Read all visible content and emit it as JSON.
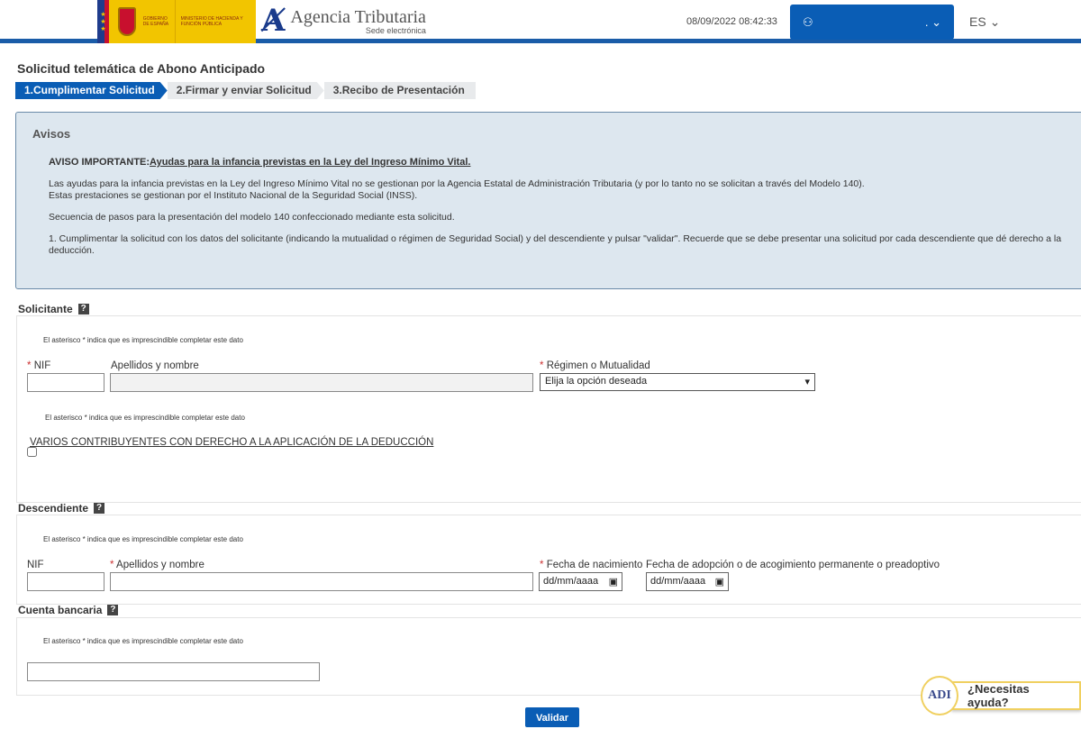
{
  "header": {
    "gov_label": "GOBIERNO DE ESPAÑA",
    "ministry_label": "MINISTERIO DE HACIENDA Y FUNCIÓN PÚBLICA",
    "agency_title": "Agencia Tributaria",
    "agency_sub": "Sede electrónica",
    "datetime": "08/09/2022 08:42:33",
    "user_name": ".",
    "lang": "ES"
  },
  "page_title": "Solicitud telemática de Abono Anticipado",
  "steps": [
    "1.Cumplimentar Solicitud",
    "2.Firmar y enviar Solicitud",
    "3.Recibo de Presentación"
  ],
  "avisos": {
    "title": "Avisos",
    "important_prefix": "AVISO IMPORTANTE:",
    "important_link": "Ayudas para la infancia previstas en la Ley del Ingreso Mínimo Vital.",
    "p1": "Las ayudas para la infancia previstas en la Ley del Ingreso Mínimo Vital no se gestionan por la Agencia Estatal de Administración Tributaria (y por lo tanto no se solicitan a través del Modelo 140).",
    "p1b": "Estas prestaciones se gestionan por el Instituto Nacional de la Seguridad Social (INSS).",
    "p2": "Secuencia de pasos para la presentación del modelo 140 confeccionado mediante esta solicitud.",
    "p3": "1. Cumplimentar la solicitud con los datos del solicitante (indicando la mutualidad o régimen de Seguridad Social) y del descendiente y pulsar \"validar\". Recuerde que se debe presentar una solicitud por cada descendiente que dé derecho a la deducción."
  },
  "note": "El asterisco * indica que es imprescindible completar este dato",
  "solicitante": {
    "title": "Solicitante",
    "nif": "NIF",
    "nombre": "Apellidos y nombre",
    "regimen": "Régimen o Mutualidad",
    "regimen_value": "Elija la opción deseada",
    "varios": "VARIOS CONTRIBUYENTES CON DERECHO A LA APLICACIÓN DE LA DEDUCCIÓN"
  },
  "descendiente": {
    "title": "Descendiente",
    "nif": "NIF",
    "nombre": "Apellidos y nombre",
    "fecha_nac": "Fecha de nacimiento",
    "fecha_adop": "Fecha de adopción o de acogimiento permanente o preadoptivo",
    "date_placeholder": "dd/mm/aaaa"
  },
  "cuenta": {
    "title": "Cuenta bancaria"
  },
  "validar": "Validar",
  "help": "¿Necesitas ayuda?",
  "help_logo": "ADI",
  "asterisk": "*"
}
